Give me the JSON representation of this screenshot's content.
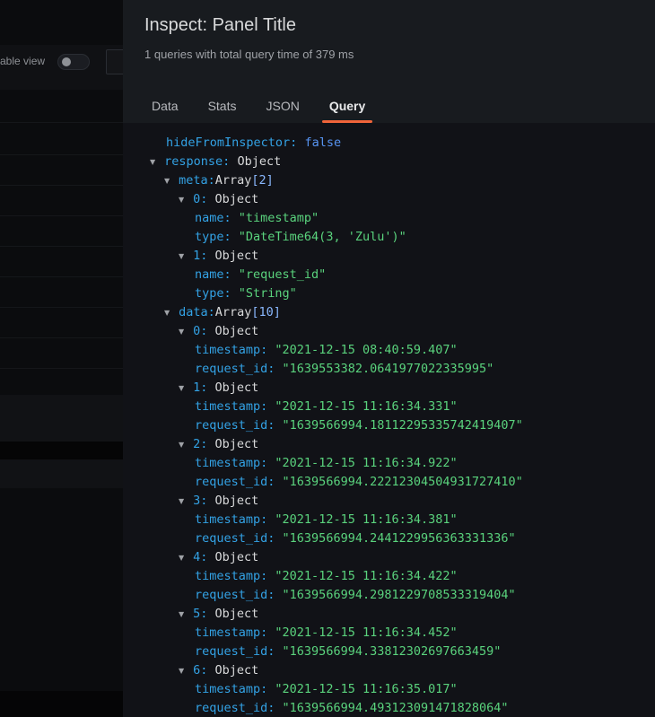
{
  "background": {
    "toggle_label": "able view"
  },
  "drawer": {
    "title": "Inspect: Panel Title",
    "subtitle": "1 queries with total query time of 379 ms",
    "tabs": [
      {
        "label": "Data",
        "active": false
      },
      {
        "label": "Stats",
        "active": false
      },
      {
        "label": "JSON",
        "active": false
      },
      {
        "label": "Query",
        "active": true
      }
    ],
    "accent_color": "#f0643a"
  },
  "tree": {
    "hide_from_inspector": {
      "key": "hideFromInspector:",
      "value": "false"
    },
    "response": {
      "key": "response:",
      "type": "Object"
    },
    "meta": {
      "key": "meta:",
      "type": "Array",
      "length": "[2]"
    },
    "meta_items": [
      {
        "index": "0:",
        "type": "Object",
        "fields": [
          {
            "key": "name:",
            "value": "\"timestamp\""
          },
          {
            "key": "type:",
            "value": "\"DateTime64(3, 'Zulu')\""
          }
        ]
      },
      {
        "index": "1:",
        "type": "Object",
        "fields": [
          {
            "key": "name:",
            "value": "\"request_id\""
          },
          {
            "key": "type:",
            "value": "\"String\""
          }
        ]
      }
    ],
    "data": {
      "key": "data:",
      "type": "Array",
      "length": "[10]"
    },
    "data_items": [
      {
        "index": "0:",
        "type": "Object",
        "fields": [
          {
            "key": "timestamp:",
            "value": "\"2021-12-15 08:40:59.407\""
          },
          {
            "key": "request_id:",
            "value": "\"1639553382.0641977022335995\""
          }
        ]
      },
      {
        "index": "1:",
        "type": "Object",
        "fields": [
          {
            "key": "timestamp:",
            "value": "\"2021-12-15 11:16:34.331\""
          },
          {
            "key": "request_id:",
            "value": "\"1639566994.18112295335742419407\""
          }
        ]
      },
      {
        "index": "2:",
        "type": "Object",
        "fields": [
          {
            "key": "timestamp:",
            "value": "\"2021-12-15 11:16:34.922\""
          },
          {
            "key": "request_id:",
            "value": "\"1639566994.22212304504931727410\""
          }
        ]
      },
      {
        "index": "3:",
        "type": "Object",
        "fields": [
          {
            "key": "timestamp:",
            "value": "\"2021-12-15 11:16:34.381\""
          },
          {
            "key": "request_id:",
            "value": "\"1639566994.2441229956363331336\""
          }
        ]
      },
      {
        "index": "4:",
        "type": "Object",
        "fields": [
          {
            "key": "timestamp:",
            "value": "\"2021-12-15 11:16:34.422\""
          },
          {
            "key": "request_id:",
            "value": "\"1639566994.2981229708533319404\""
          }
        ]
      },
      {
        "index": "5:",
        "type": "Object",
        "fields": [
          {
            "key": "timestamp:",
            "value": "\"2021-12-15 11:16:34.452\""
          },
          {
            "key": "request_id:",
            "value": "\"1639566994.33812302697663459\""
          }
        ]
      },
      {
        "index": "6:",
        "type": "Object",
        "fields": [
          {
            "key": "timestamp:",
            "value": "\"2021-12-15 11:16:35.017\""
          },
          {
            "key": "request_id:",
            "value": "\"1639566994.493123091471828064\""
          }
        ]
      }
    ]
  }
}
